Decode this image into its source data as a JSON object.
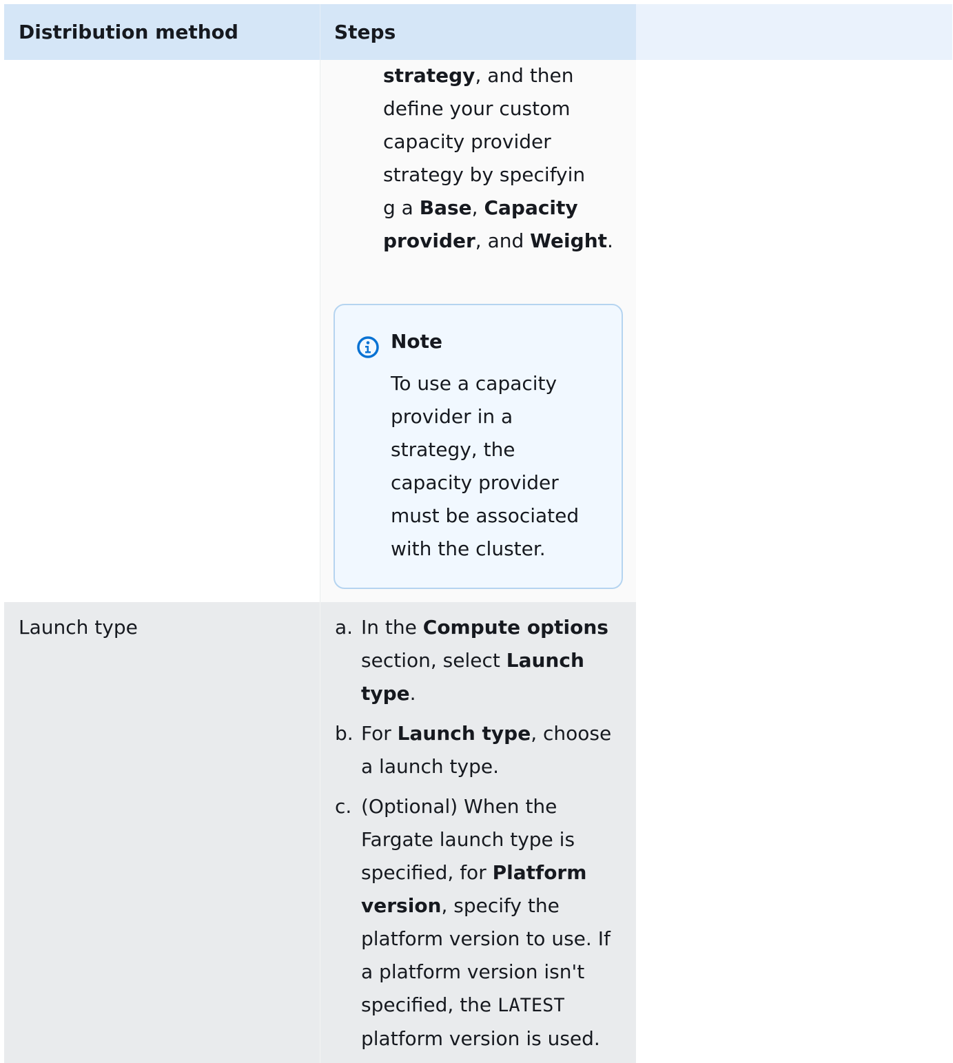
{
  "table": {
    "headers": [
      "Distribution method",
      "Steps"
    ]
  },
  "row1": {
    "continuation": {
      "s1_bold": "strategy",
      "s1": ", and then\ndefine your custom\ncapacity provider\nstrategy by specifyin\ng a ",
      "base": "Base",
      "comma": ", ",
      "capacity_provider": "Capacity\nprovider",
      "and": ", and ",
      "weight": "Weight",
      "period": "."
    },
    "note": {
      "icon": "info-icon",
      "title": "Note",
      "text": "To use a capacity\nprovider in a\nstrategy, the\ncapacity provider\nmust be associated\nwith the cluster."
    }
  },
  "row2": {
    "method": "Launch type",
    "steps": [
      {
        "marker": "a.",
        "p1": "In the ",
        "b1": "Compute options",
        "p2": " section, select ",
        "b2": "Launch type",
        "p3": "."
      },
      {
        "marker": "b.",
        "p1": "For ",
        "b1": "Launch type",
        "p2": ", choose a launch type."
      },
      {
        "marker": "c.",
        "p1": "(Optional) When the Fargate launch type is specified, for ",
        "b1": "Platform version",
        "p2": ", specify the platform version to use. If a platform version isn't specified, the ",
        "code": "LATEST",
        "p3": " platform version is used."
      }
    ]
  },
  "colors": {
    "header_bg": "#d5e6f7",
    "header_extra_bg": "#eaf2fc",
    "row_alt_bg": "#e9ebed",
    "note_bg": "#f1f8ff",
    "note_border": "#b5d4f0",
    "info_icon": "#0972d3"
  }
}
